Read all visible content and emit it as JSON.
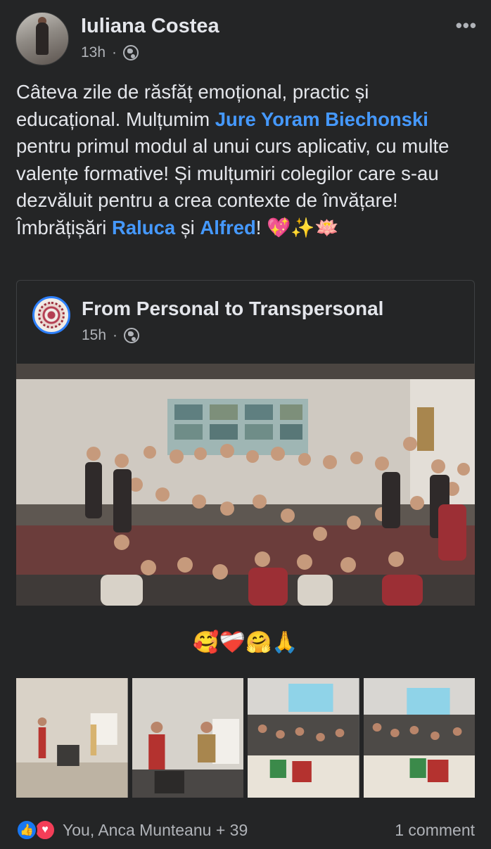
{
  "post": {
    "author": "Iuliana Costea",
    "time": "13h",
    "privacy_icon": "globe-icon",
    "more_icon": "more-options-icon",
    "text": {
      "part1": "Câteva zile de răsfăț emoțional, practic și educațional. Mulțumim ",
      "mention1": "Jure Yoram Biechonski",
      "part2": " pentru primul modul al unui curs aplicativ, cu multe valențe formative! Și mulțumiri colegilor care s-au dezvăluit pentru a crea contexte de învățare! Îmbrățișări ",
      "mention2": "Raluca",
      "part3": " și ",
      "mention3": "Alfred",
      "part4": "! 💖✨🪷"
    }
  },
  "shared_post": {
    "page_name": "From Personal to Transpersonal",
    "time": "15h",
    "privacy_icon": "globe-icon",
    "emoji_line": "🥰❤️‍🩹🤗🙏"
  },
  "footer": {
    "reactions_text": "You, Anca Munteanu + 39",
    "comments_text": "1 comment",
    "reaction_icons": [
      "like-icon",
      "love-icon"
    ]
  },
  "colors": {
    "background": "#242526",
    "mention": "#4599ff",
    "like": "#1877f2",
    "love": "#f33e58"
  }
}
